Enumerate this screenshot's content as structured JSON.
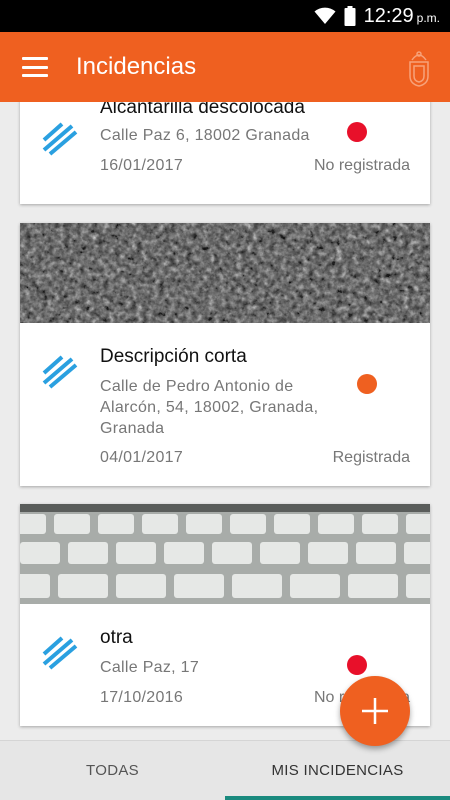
{
  "status_bar": {
    "time": "12:29",
    "ampm": "p.m."
  },
  "app_bar": {
    "title": "Incidencias",
    "icons": [
      "menu-icon",
      "crest-icon"
    ]
  },
  "incidents": [
    {
      "title": "Alcantarilla descolocada",
      "address": "Calle Paz 6, 18002 Granada",
      "date": "16/01/2017",
      "status": "No registrada",
      "status_color": "#e8102a"
    },
    {
      "title": "Descripción corta",
      "address": "Calle de Pedro Antonio de Alarcón, 54, 18002, Granada, Granada",
      "date": "04/01/2017",
      "status": "Registrada",
      "status_color": "#ef6020"
    },
    {
      "title": "otra",
      "address": "Calle Paz, 17",
      "date": "17/10/2016",
      "status": "No registrada",
      "status_color": "#e8102a"
    }
  ],
  "tabs": [
    {
      "label": "TODAS",
      "active": false
    },
    {
      "label": "MIS INCIDENCIAS",
      "active": true
    }
  ],
  "colors": {
    "primary": "#ef6020",
    "accent": "#1a8a7e",
    "icon_blue": "#2aa0e0"
  }
}
